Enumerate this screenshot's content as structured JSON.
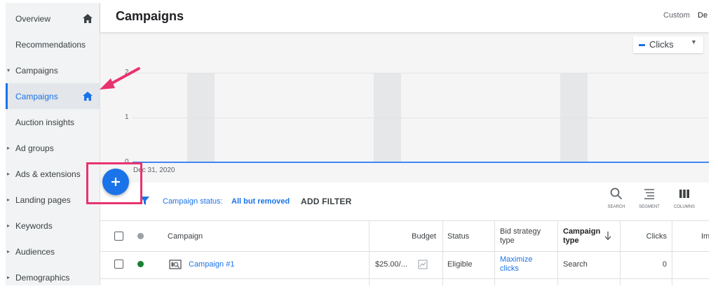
{
  "sidebar": {
    "items": [
      {
        "label": "Overview",
        "caret": ""
      },
      {
        "label": "Recommendations",
        "caret": ""
      },
      {
        "label": "Campaigns",
        "caret": "▾"
      },
      {
        "label": "Campaigns",
        "caret": ""
      },
      {
        "label": "Auction insights",
        "caret": ""
      },
      {
        "label": "Ad groups",
        "caret": "▸"
      },
      {
        "label": "Ads & extensions",
        "caret": "▸"
      },
      {
        "label": "Landing pages",
        "caret": "▸"
      },
      {
        "label": "Keywords",
        "caret": "▸"
      },
      {
        "label": "Audiences",
        "caret": "▸"
      },
      {
        "label": "Demographics",
        "caret": "▸"
      }
    ],
    "active_index": 3
  },
  "header": {
    "title": "Campaigns",
    "date_label": "Custom",
    "date_value": "De"
  },
  "chart": {
    "metric": "Clicks",
    "y_ticks": [
      "2",
      "1",
      "0"
    ],
    "x_label": "Dec 31, 2020"
  },
  "toolbar": {
    "filter_prefix": "Campaign status:",
    "filter_value": "All but removed",
    "add_filter": "ADD FILTER",
    "tools": [
      {
        "name": "search",
        "label": "SEARCH"
      },
      {
        "name": "segment",
        "label": "SEGMENT"
      },
      {
        "name": "columns",
        "label": "COLUMNS"
      }
    ]
  },
  "table": {
    "headers": {
      "campaign": "Campaign",
      "budget": "Budget",
      "status": "Status",
      "bid_strategy": "Bid strategy type",
      "campaign_type": "Campaign type",
      "clicks": "Clicks",
      "impr": "Im"
    },
    "rows": [
      {
        "campaign": "Campaign #1",
        "budget": "$25.00/...",
        "status": "Eligible",
        "bid_strategy": "Maximize clicks",
        "campaign_type": "Search",
        "clicks": "0"
      }
    ]
  },
  "colors": {
    "accent": "#1a73e8",
    "highlight": "#e8336d",
    "status_enabled": "#188038"
  }
}
